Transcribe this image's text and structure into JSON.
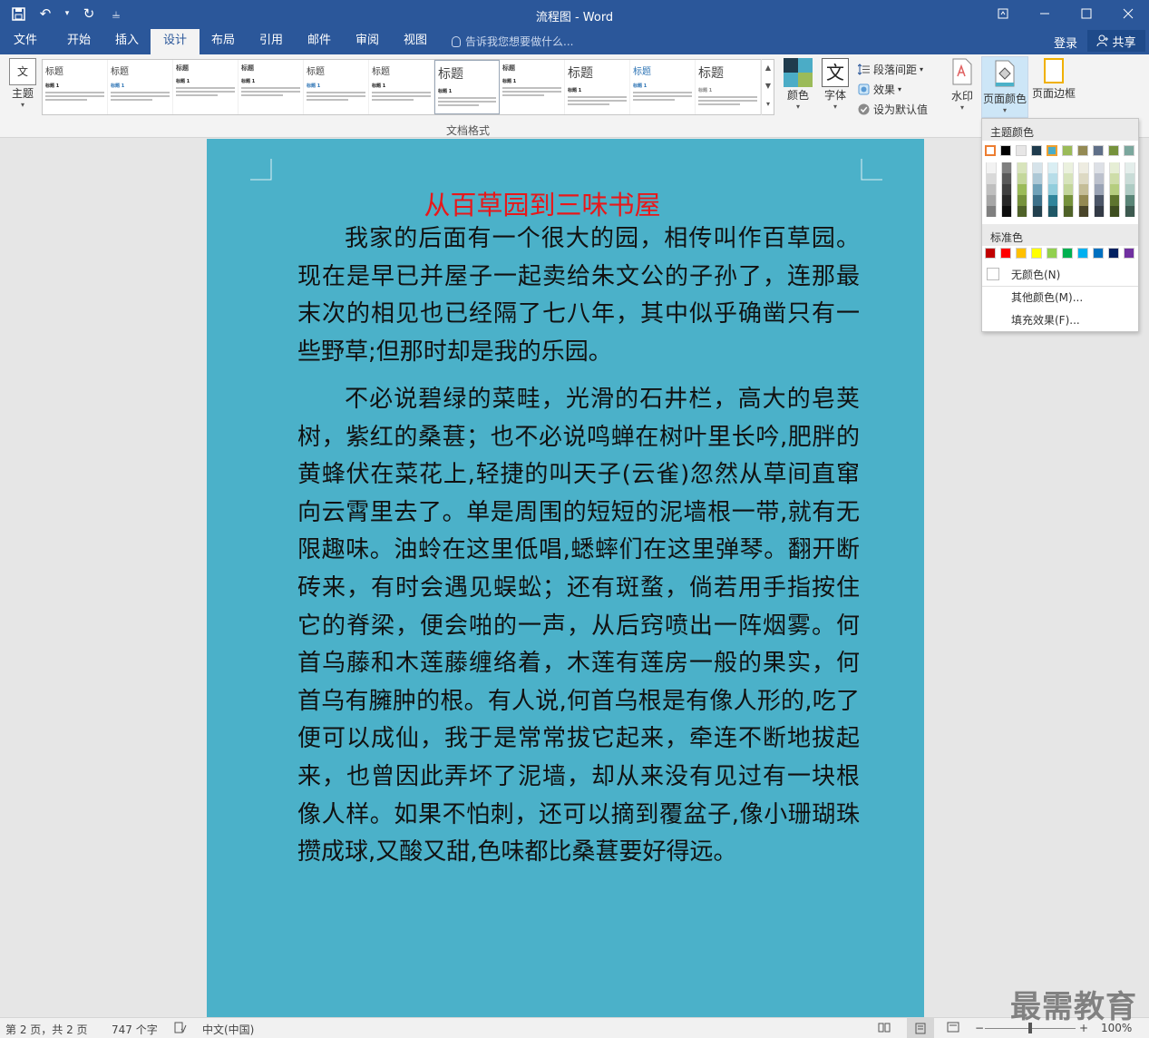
{
  "window": {
    "title": "流程图 - Word"
  },
  "qat": {
    "save_icon": "save-icon",
    "undo_icon": "undo-icon",
    "redo_icon": "redo-icon",
    "customize_icon": "customize-qat-icon"
  },
  "tabs": [
    {
      "label": "文件"
    },
    {
      "label": "开始"
    },
    {
      "label": "插入"
    },
    {
      "label": "设计"
    },
    {
      "label": "布局"
    },
    {
      "label": "引用"
    },
    {
      "label": "邮件"
    },
    {
      "label": "审阅"
    },
    {
      "label": "视图"
    }
  ],
  "active_tab": "设计",
  "tell_me": "告诉我您想要做什么...",
  "account": {
    "login": "登录",
    "share": "共享"
  },
  "ribbon": {
    "theme_label": "主题",
    "theme_icon_text": "文",
    "gallery_group_label": "文档格式",
    "styles": [
      {
        "title": "标题",
        "sub": "标题 1"
      },
      {
        "title": "标题",
        "sub": "标题 1"
      },
      {
        "title": "标题",
        "sub": "标题 1"
      },
      {
        "title": "标题",
        "sub": "标题 1"
      },
      {
        "title": "标题",
        "sub": "标题 1"
      },
      {
        "title": "标题",
        "sub": "标题 1"
      },
      {
        "title": "标题",
        "sub": "标题 1"
      },
      {
        "title": "标题",
        "sub": "标题 1"
      },
      {
        "title": "标题",
        "sub": "标题 1"
      },
      {
        "title": "标题",
        "sub": "标题 1"
      },
      {
        "title": "标题",
        "sub": "标题 1"
      }
    ],
    "colors_label": "颜色",
    "fonts_label": "字体",
    "fonts_icon_text": "文",
    "paragraph_spacing": "段落间距",
    "effects": "效果",
    "set_default": "设为默认值",
    "watermark": "水印",
    "page_color": "页面颜色",
    "page_borders": "页面边框"
  },
  "document": {
    "title": "从百草园到三味书屋",
    "paragraphs": [
      "我家的后面有一个很大的园，相传叫作百草园。现在是早已并屋子一起卖给朱文公的子孙了，连那最末次的相见也已经隔了七八年，其中似乎确凿只有一些野草;但那时却是我的乐园。",
      "不必说碧绿的菜畦，光滑的石井栏，高大的皂荚树，紫红的桑葚；也不必说鸣蝉在树叶里长吟,肥胖的黄蜂伏在菜花上,轻捷的叫天子(云雀)忽然从草间直窜向云霄里去了。单是周围的短短的泥墙根一带,就有无限趣味。油蛉在这里低唱,蟋蟀们在这里弹琴。翻开断砖来，有时会遇见蜈蚣；还有斑蝥，倘若用手指按住它的脊梁，便会啪的一声，从后窍喷出一阵烟雾。何首乌藤和木莲藤缠络着，木莲有莲房一般的果实，何首乌有臃肿的根。有人说,何首乌根是有像人形的,吃了便可以成仙，我于是常常拔它起来，牵连不断地拔起来，也曾因此弄坏了泥墙，却从来没有见过有一块根像人样。如果不怕刺，还可以摘到覆盆子,像小珊瑚珠攒成球,又酸又甜,色味都比桑葚要好得远。"
    ],
    "page_color": "#4bb1c9",
    "title_color": "#e8181a"
  },
  "page_color_menu": {
    "theme_header": "主题颜色",
    "standard_header": "标准色",
    "theme_top_row": [
      "#ffffff",
      "#000000",
      "#e7e6e6",
      "#1f3b4d",
      "#4bacc6",
      "#9bbb59",
      "#948a54",
      "#5f6f88",
      "#76923c",
      "#7ba79d"
    ],
    "theme_columns": [
      [
        "#f2f2f2",
        "#d9d9d9",
        "#bfbfbf",
        "#a6a6a6",
        "#7f7f7f"
      ],
      [
        "#7f7f7f",
        "#595959",
        "#3f3f3f",
        "#262626",
        "#0d0d0d"
      ],
      [
        "#d8e4bc",
        "#c4d79b",
        "#9bbb59",
        "#76923c",
        "#4f6228"
      ],
      [
        "#d6e3ea",
        "#adc8d6",
        "#6fa1b8",
        "#3c7089",
        "#22404e"
      ],
      [
        "#daeef3",
        "#b7dde8",
        "#92cddc",
        "#31859b",
        "#205867"
      ],
      [
        "#ebf1de",
        "#d7e4bc",
        "#c3d69b",
        "#76923c",
        "#4f6228"
      ],
      [
        "#eeece1",
        "#ddd9c3",
        "#c4bd97",
        "#938953",
        "#494529"
      ],
      [
        "#dde0e6",
        "#bcc1cd",
        "#9aa3b5",
        "#4c5668",
        "#333a46"
      ],
      [
        "#e6eed5",
        "#cedda9",
        "#b5cd7f",
        "#5e752e",
        "#3e4e1f"
      ],
      [
        "#e4eeeb",
        "#c9dcd7",
        "#aecbc3",
        "#5a8577",
        "#3c594f"
      ]
    ],
    "standard_colors": [
      "#c00000",
      "#ff0000",
      "#ffc000",
      "#ffff00",
      "#92d050",
      "#00b050",
      "#00b0f0",
      "#0070c0",
      "#002060",
      "#7030a0"
    ],
    "no_color": "无颜色(N)",
    "more_colors": "其他颜色(M)...",
    "fill_effects": "填充效果(F)..."
  },
  "status": {
    "page": "第 2 页，共 2 页",
    "words": "747 个字",
    "language": "中文(中国)",
    "zoom": "100%"
  },
  "watermark_text": "最需教育"
}
